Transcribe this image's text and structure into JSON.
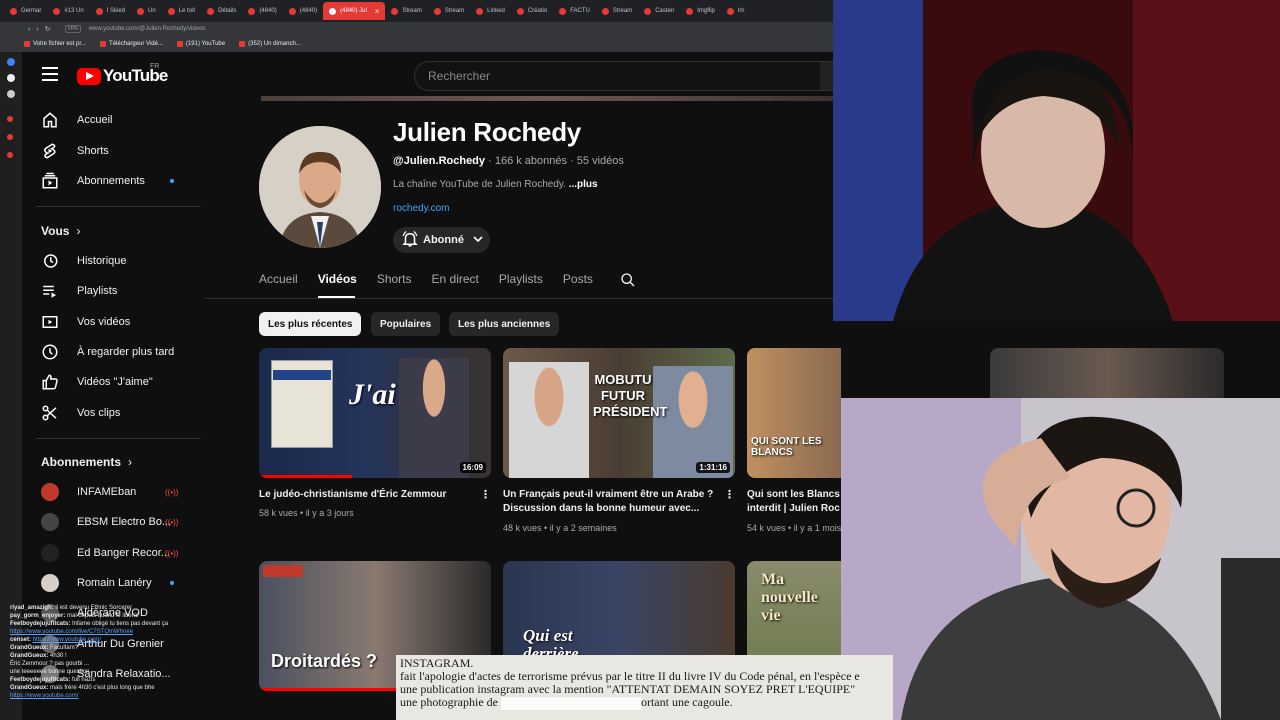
{
  "browser": {
    "tabs": [
      "Germar",
      "#13 Un",
      "I Skied",
      "Un",
      "Le toit",
      "Détails",
      "(4840)",
      "(4840)",
      "(4840) Jul",
      "Stream",
      "Stream",
      "Linked",
      "Créatio",
      "FACTU",
      "Stream",
      "Casten",
      "Imgflip",
      "Im"
    ],
    "active_tab_index": 8,
    "address": "www.youtube.com/@Julien.Rochedy/videos",
    "vpn_label": "VPN",
    "bookmarks": [
      "Votre fichier est pr...",
      "Téléchargeur Vidé...",
      "(191) YouTube",
      "(352) Un dimanch..."
    ]
  },
  "youtube": {
    "logo_text": "YouTube",
    "country": "FR",
    "search_placeholder": "Rechercher"
  },
  "sidebar": {
    "main": [
      {
        "label": "Accueil",
        "icon": "home-icon"
      },
      {
        "label": "Shorts",
        "icon": "shorts-icon"
      },
      {
        "label": "Abonnements",
        "icon": "subscriptions-icon",
        "dot": true
      }
    ],
    "you_heading": "Vous",
    "you": [
      {
        "label": "Historique",
        "icon": "history-icon"
      },
      {
        "label": "Playlists",
        "icon": "playlists-icon"
      },
      {
        "label": "Vos vidéos",
        "icon": "your-videos-icon"
      },
      {
        "label": "À regarder plus tard",
        "icon": "watch-later-icon"
      },
      {
        "label": "Vidéos \"J'aime\"",
        "icon": "like-icon"
      },
      {
        "label": "Vos clips",
        "icon": "clips-icon"
      }
    ],
    "subs_heading": "Abonnements",
    "subscriptions": [
      {
        "label": "INFAMEban",
        "live": true,
        "avatar_color": "#c0392b"
      },
      {
        "label": "EBSM Electro Bo...",
        "live": true,
        "avatar_color": "#444444"
      },
      {
        "label": "Ed Banger Recor...",
        "live": true,
        "avatar_color": "#222222"
      },
      {
        "label": "Romain Lanéry",
        "dot": true,
        "avatar_color": "#d8d0c8"
      },
      {
        "label": "Aldérane VOD",
        "avatar_color": "#555555"
      },
      {
        "label": "Arthur Du Grenier",
        "avatar_color": "#666666"
      },
      {
        "label": "Sandra Relaxatio...",
        "avatar_color": "#777777"
      }
    ]
  },
  "channel": {
    "name": "Julien Rochedy",
    "handle": "@Julien.Rochedy",
    "subscribers": "166 k abonnés",
    "videos_count": "55 vidéos",
    "description": "La chaîne YouTube de Julien Rochedy.",
    "more": "...plus",
    "link": "rochedy.com",
    "subscribed_label": "Abonné",
    "tabs": [
      "Accueil",
      "Vidéos",
      "Shorts",
      "En direct",
      "Playlists",
      "Posts"
    ],
    "active_tab": "Vidéos",
    "sort_chips": [
      "Les plus récentes",
      "Populaires",
      "Les plus anciennes"
    ],
    "active_chip": "Les plus récentes"
  },
  "videos": [
    {
      "title": "Le judéo-christianisme d'Éric Zemmour",
      "views": "58 k vues",
      "age": "il y a 3 jours",
      "duration": "16:09",
      "thumb_text": "J'ai lu.",
      "progress": 0.4
    },
    {
      "title": "Un Français peut-il vraiment être un Arabe ? Discussion dans la bonne humeur avec...",
      "views": "48 k vues",
      "age": "il y a 2 semaines",
      "duration": "1:31:16",
      "thumb_text": "MOBUTU FUTUR PRÉSIDENT",
      "progress": 0
    },
    {
      "title": "Qui sont les Blancs interdit | Julien Roc",
      "views": "54 k vues",
      "age": "il y a 1 mois",
      "duration": "",
      "thumb_text": "QUI SONT LES BLANCS",
      "progress": 0
    },
    {
      "title": "",
      "views": "",
      "age": "",
      "duration": "",
      "thumb_text": "",
      "progress": 0
    },
    {
      "title": "",
      "views": "",
      "age": "",
      "duration": "",
      "thumb_text": "Droitardés ?",
      "progress": 1
    },
    {
      "title": "",
      "views": "",
      "age": "",
      "duration": "",
      "thumb_text": "Qui est derrière",
      "progress": 0
    },
    {
      "title": "",
      "views": "",
      "age": "",
      "duration": "",
      "thumb_text": "Ma nouvelle vie",
      "progress": 0
    }
  ],
  "document_overlay": {
    "line1": "INSTAGRAM.",
    "line2": "fait l'apologie d'actes de terrorisme prévus par le titre II du livre IV du Code pénal, en l'espèce e",
    "line3": "une publication instagram avec la mention \"ATTENTAT DEMAIN SOYEZ PRET L'EQUIPE\"",
    "line4a": "une photographie de",
    "line4b": "ortant une cagoule."
  },
  "chat": [
    {
      "user": "riyad_amazigh:",
      "text": "il est devenu Ethnic Sorcerer"
    },
    {
      "user": "pay_gorm_enjoyer:",
      "text": "mai depuis quand le liberal"
    },
    {
      "user": "Feetboydejujufitcats:",
      "text": "Infame obligé tu tiens pas devant ça"
    },
    {
      "user": "",
      "text": "https://www.youtube.com/live/C7STQmWhnee"
    },
    {
      "user": "censet:",
      "text": "https://www.youtube.com/"
    },
    {
      "user": "GrandGueux:",
      "text": "Facultam?"
    },
    {
      "user": "GrandGueux:",
      "text": "4h30 !"
    },
    {
      "user": "",
      "text": "Éric Zemmour ? pas gourbi ..."
    },
    {
      "user": "",
      "text": "une teeeeeee bonne question"
    },
    {
      "user": "Feetboydejujufitcats:",
      "text": "full nazis"
    },
    {
      "user": "GrandGueux:",
      "text": "mais frère 4h30 c'est plus long que bhe"
    },
    {
      "user": "",
      "text": "https://www.youtube.com/"
    }
  ],
  "colors": {
    "accent_red": "#ff0000",
    "link_blue": "#3ea6ff",
    "bg": "#0f0f0f"
  }
}
